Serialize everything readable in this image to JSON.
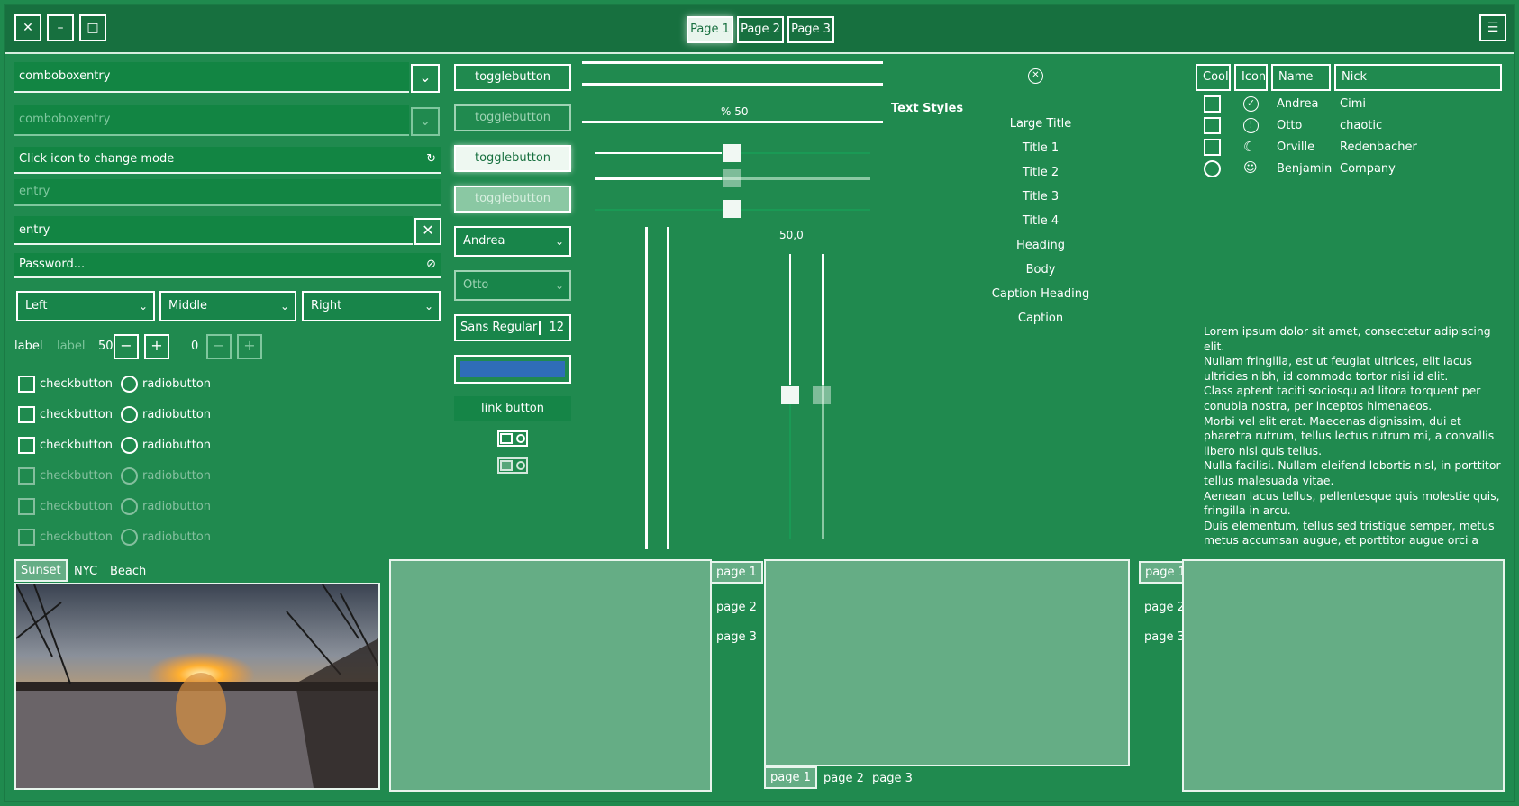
{
  "titlebar": {
    "tabs": [
      "Page 1",
      "Page 2",
      "Page 3"
    ],
    "close_glyph": "✕",
    "minimize_glyph": "–",
    "maximize_glyph": "□",
    "menu_glyph": "☰"
  },
  "left": {
    "combo1_value": "comboboxentry",
    "combo2_placeholder": "comboboxentry",
    "icon_entry": "Click icon to change mode",
    "entry_placeholder": "entry",
    "entry_value": "entry",
    "password_placeholder": "Password...",
    "drop_left": "Left",
    "drop_middle": "Middle",
    "drop_right": "Right",
    "label1": "label",
    "label2": "label",
    "spin1": "50",
    "spin2": "0",
    "check_label": "checkbutton",
    "radio_label": "radiobutton"
  },
  "middle": {
    "toggles": [
      "togglebutton",
      "togglebutton",
      "togglebutton",
      "togglebutton"
    ],
    "combo_andrea": "Andrea",
    "combo_otto": "Otto",
    "font_name": "Sans Regular",
    "font_size": "12",
    "link": "link button",
    "color_button": "#2f6db8"
  },
  "sliders": {
    "progress_label": "% 50",
    "scale_label": "50,0",
    "progress_value": 0.5
  },
  "text_styles": {
    "heading": "Text Styles",
    "items": [
      "Large Title",
      "Title 1",
      "Title 2",
      "Title 3",
      "Title 4",
      "Heading",
      "Body",
      "Caption Heading",
      "Caption"
    ]
  },
  "table": {
    "headers": [
      "Cool",
      "Icon",
      "Name",
      "Nick"
    ],
    "rows": [
      {
        "name": "Andrea",
        "nick": "Cimi",
        "icon": "check-circle-icon"
      },
      {
        "name": "Otto",
        "nick": "chaotic",
        "icon": "alert-circle-icon"
      },
      {
        "name": "Orville",
        "nick": "Redenbacher",
        "icon": "moon-icon"
      },
      {
        "name": "Benjamin",
        "nick": "Company",
        "icon": "face-icon"
      }
    ]
  },
  "lorem": "Lorem ipsum dolor sit amet, consectetur adipiscing elit.\nNullam fringilla, est ut feugiat ultrices, elit lacus ultricies nibh, id commodo tortor nisi id elit.\nClass aptent taciti sociosqu ad litora torquent per conubia nostra, per inceptos himenaeos.\nMorbi vel elit erat. Maecenas dignissim, dui et pharetra rutrum, tellus lectus rutrum mi, a convallis libero nisi quis tellus.\nNulla facilisi. Nullam eleifend lobortis nisl, in porttitor tellus malesuada vitae.\nAenean lacus tellus, pellentesque quis molestie quis, fringilla in arcu.\nDuis elementum, tellus sed tristique semper, metus metus accumsan augue, et porttitor augue orci a libero.\nUt sed justo ac felis placerat laoreet sed id sem. Proin",
  "image_tabs": [
    "Sunset",
    "NYC",
    "Beach"
  ],
  "notebook_tabs": [
    "page 1",
    "page 2",
    "page 3"
  ]
}
